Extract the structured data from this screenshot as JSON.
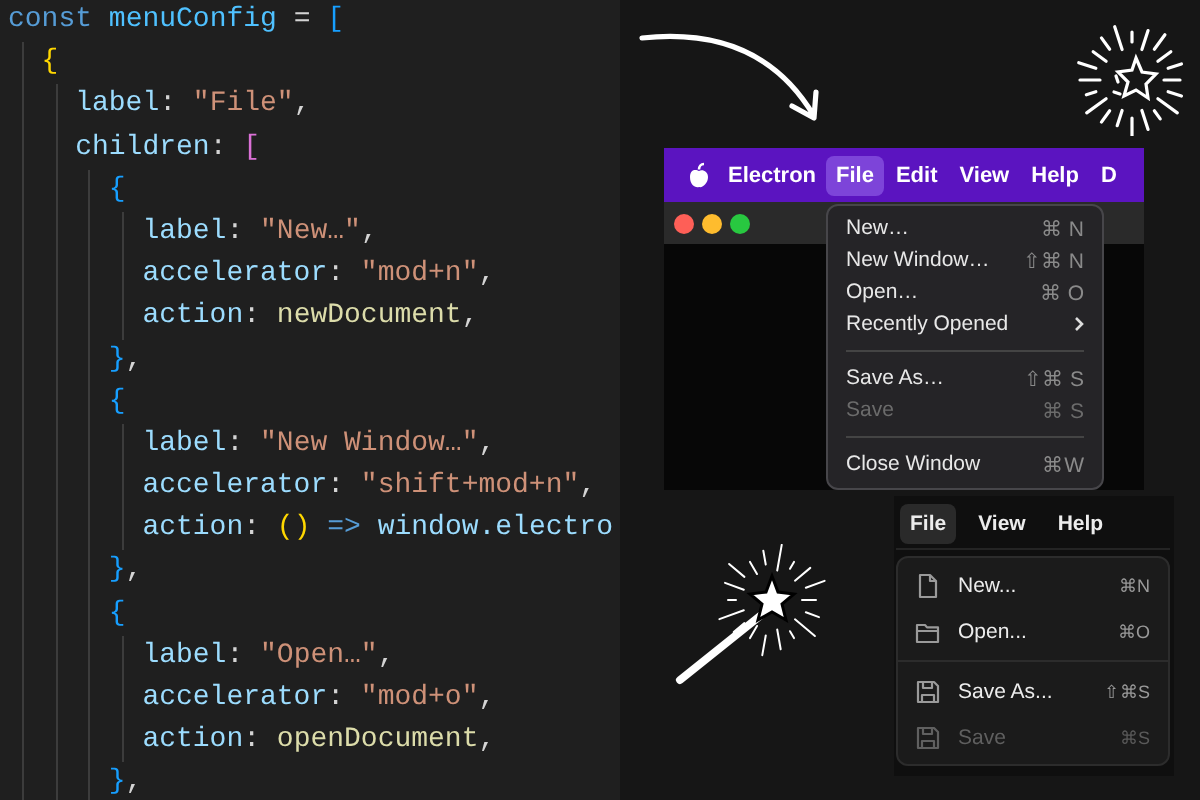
{
  "code": {
    "lines": [
      {
        "tokens": [
          {
            "kind": "keyword",
            "text": "const "
          },
          {
            "kind": "variable",
            "text": "menuConfig"
          },
          {
            "kind": "plain",
            "text": " = "
          },
          {
            "kind": "brace3",
            "text": "["
          }
        ],
        "children": [
          {
            "tokens": [
              {
                "kind": "brace1",
                "text": "{"
              }
            ],
            "children": [
              {
                "tokens": [
                  {
                    "kind": "property",
                    "text": "label"
                  },
                  {
                    "kind": "plain",
                    "text": ": "
                  },
                  {
                    "kind": "string",
                    "text": "\"File\""
                  },
                  {
                    "kind": "plain",
                    "text": ","
                  }
                ]
              },
              {
                "tokens": [
                  {
                    "kind": "property",
                    "text": "children"
                  },
                  {
                    "kind": "plain",
                    "text": ": "
                  },
                  {
                    "kind": "brace2",
                    "text": "["
                  }
                ],
                "children": [
                  {
                    "tokens": [
                      {
                        "kind": "brace3",
                        "text": "{"
                      }
                    ],
                    "children": [
                      {
                        "tokens": [
                          {
                            "kind": "property",
                            "text": "label"
                          },
                          {
                            "kind": "plain",
                            "text": ": "
                          },
                          {
                            "kind": "string",
                            "text": "\"New…\""
                          },
                          {
                            "kind": "plain",
                            "text": ","
                          }
                        ]
                      },
                      {
                        "tokens": [
                          {
                            "kind": "property",
                            "text": "accelerator"
                          },
                          {
                            "kind": "plain",
                            "text": ": "
                          },
                          {
                            "kind": "string",
                            "text": "\"mod+n\""
                          },
                          {
                            "kind": "plain",
                            "text": ","
                          }
                        ]
                      },
                      {
                        "tokens": [
                          {
                            "kind": "property",
                            "text": "action"
                          },
                          {
                            "kind": "plain",
                            "text": ": "
                          },
                          {
                            "kind": "function",
                            "text": "newDocument"
                          },
                          {
                            "kind": "plain",
                            "text": ","
                          }
                        ]
                      }
                    ]
                  },
                  {
                    "tokens": [
                      {
                        "kind": "brace3",
                        "text": "}"
                      },
                      {
                        "kind": "plain",
                        "text": ","
                      }
                    ]
                  },
                  {
                    "tokens": [
                      {
                        "kind": "brace3",
                        "text": "{"
                      }
                    ],
                    "children": [
                      {
                        "tokens": [
                          {
                            "kind": "property",
                            "text": "label"
                          },
                          {
                            "kind": "plain",
                            "text": ": "
                          },
                          {
                            "kind": "string",
                            "text": "\"New Window…\""
                          },
                          {
                            "kind": "plain",
                            "text": ","
                          }
                        ]
                      },
                      {
                        "tokens": [
                          {
                            "kind": "property",
                            "text": "accelerator"
                          },
                          {
                            "kind": "plain",
                            "text": ": "
                          },
                          {
                            "kind": "string",
                            "text": "\"shift+mod+n\""
                          },
                          {
                            "kind": "plain",
                            "text": ","
                          }
                        ]
                      },
                      {
                        "tokens": [
                          {
                            "kind": "property",
                            "text": "action"
                          },
                          {
                            "kind": "plain",
                            "text": ": "
                          },
                          {
                            "kind": "brace1",
                            "text": "()"
                          },
                          {
                            "kind": "keyword",
                            "text": " =>"
                          },
                          {
                            "kind": "property",
                            "text": " window.electro"
                          }
                        ]
                      }
                    ]
                  },
                  {
                    "tokens": [
                      {
                        "kind": "brace3",
                        "text": "}"
                      },
                      {
                        "kind": "plain",
                        "text": ","
                      }
                    ]
                  },
                  {
                    "tokens": [
                      {
                        "kind": "brace3",
                        "text": "{"
                      }
                    ],
                    "children": [
                      {
                        "tokens": [
                          {
                            "kind": "property",
                            "text": "label"
                          },
                          {
                            "kind": "plain",
                            "text": ": "
                          },
                          {
                            "kind": "string",
                            "text": "\"Open…\""
                          },
                          {
                            "kind": "plain",
                            "text": ","
                          }
                        ]
                      },
                      {
                        "tokens": [
                          {
                            "kind": "property",
                            "text": "accelerator"
                          },
                          {
                            "kind": "plain",
                            "text": ": "
                          },
                          {
                            "kind": "string",
                            "text": "\"mod+o\""
                          },
                          {
                            "kind": "plain",
                            "text": ","
                          }
                        ]
                      },
                      {
                        "tokens": [
                          {
                            "kind": "property",
                            "text": "action"
                          },
                          {
                            "kind": "plain",
                            "text": ": "
                          },
                          {
                            "kind": "function",
                            "text": "openDocument"
                          },
                          {
                            "kind": "plain",
                            "text": ","
                          }
                        ]
                      }
                    ]
                  },
                  {
                    "tokens": [
                      {
                        "kind": "brace3",
                        "text": "}"
                      },
                      {
                        "kind": "plain",
                        "text": ","
                      }
                    ]
                  }
                ]
              }
            ]
          }
        ]
      }
    ]
  },
  "mac_screenshot": {
    "app_name": "Electron",
    "menubar": [
      {
        "label": "File",
        "selected": true
      },
      {
        "label": "Edit",
        "selected": false
      },
      {
        "label": "View",
        "selected": false
      },
      {
        "label": "Help",
        "selected": false
      },
      {
        "label": "D",
        "selected": false
      }
    ],
    "menu": [
      {
        "kind": "item",
        "label": "New…",
        "shortcut": "⌘ N",
        "disabled": false,
        "submenu": false
      },
      {
        "kind": "item",
        "label": "New Window…",
        "shortcut": "⇧⌘ N",
        "disabled": false,
        "submenu": false
      },
      {
        "kind": "item",
        "label": "Open…",
        "shortcut": "⌘ O",
        "disabled": false,
        "submenu": false
      },
      {
        "kind": "item",
        "label": "Recently Opened",
        "disabled": false,
        "submenu": true
      },
      {
        "kind": "separator"
      },
      {
        "kind": "item",
        "label": "Save As…",
        "shortcut": "⇧⌘ S",
        "disabled": false,
        "submenu": false
      },
      {
        "kind": "item",
        "label": "Save",
        "shortcut": "⌘ S",
        "disabled": true,
        "submenu": false
      },
      {
        "kind": "separator"
      },
      {
        "kind": "item",
        "label": "Close Window",
        "shortcut": "⌘W",
        "disabled": false,
        "submenu": false
      }
    ]
  },
  "app_screenshot": {
    "menubar": [
      {
        "label": "File",
        "selected": true
      },
      {
        "label": "View",
        "selected": false
      },
      {
        "label": "Help",
        "selected": false
      }
    ],
    "menu": [
      {
        "kind": "file",
        "label": "New...",
        "shortcut": "⌘N",
        "disabled": false
      },
      {
        "kind": "folder",
        "label": "Open...",
        "shortcut": "⌘O",
        "disabled": false
      },
      {
        "kind": "separator"
      },
      {
        "kind": "save",
        "label": "Save As...",
        "shortcut": "⇧⌘S",
        "disabled": false
      },
      {
        "kind": "save",
        "label": "Save",
        "shortcut": "⌘S",
        "disabled": true
      }
    ]
  }
}
